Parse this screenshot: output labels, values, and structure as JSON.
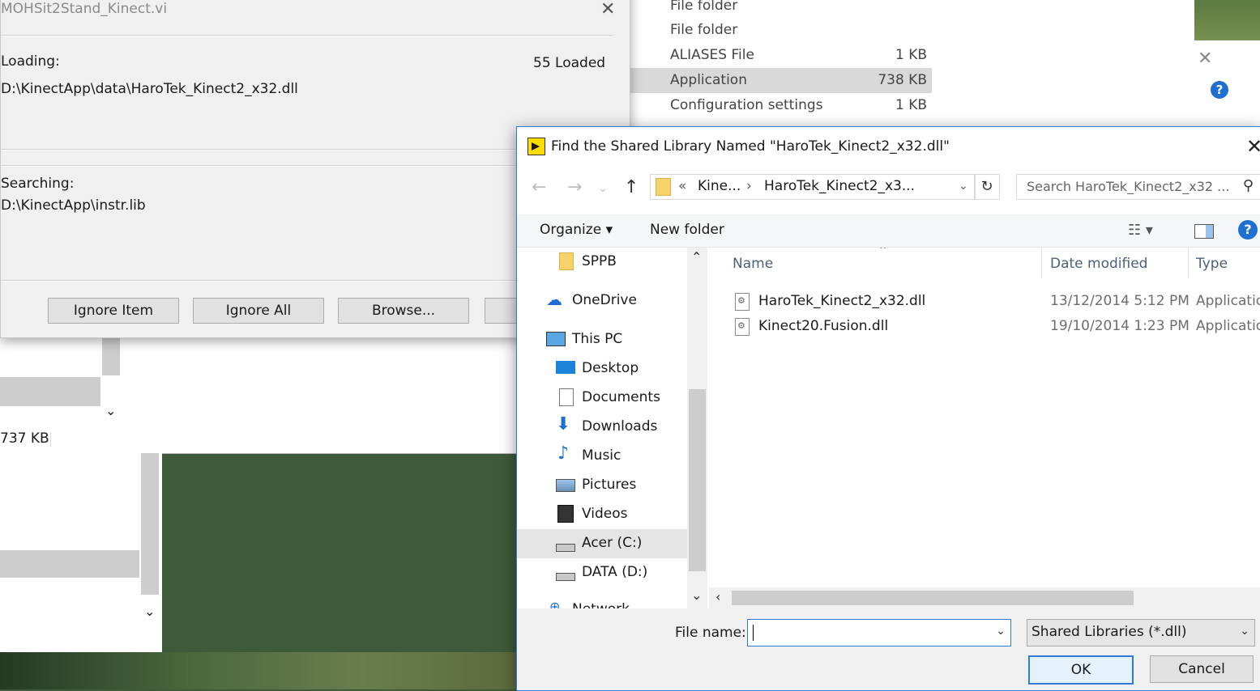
{
  "bg_explorer": {
    "rows": [
      {
        "type": "File folder",
        "size": ""
      },
      {
        "type": "File folder",
        "size": ""
      },
      {
        "type": "ALIASES File",
        "size": "1 KB"
      },
      {
        "type": "Application",
        "size": "738 KB"
      },
      {
        "type": "Configuration settings",
        "size": "1 KB"
      }
    ],
    "partial_size": "737 KB"
  },
  "loading_dialog": {
    "title": "MOHSit2Stand_Kinect.vi",
    "loading_label": "Loading:",
    "loaded_count": "55 Loaded",
    "loading_path": "D:\\KinectApp\\data\\HaroTek_Kinect2_x32.dll",
    "searching_label": "Searching:",
    "searching_path": "D:\\KinectApp\\instr.lib",
    "buttons": {
      "ignore_item": "Ignore Item",
      "ignore_all": "Ignore All",
      "browse": "Browse..."
    }
  },
  "find_dialog": {
    "title": "Find the Shared Library Named \"HaroTek_Kinect2_x32.dll\"",
    "address": {
      "prefix": "«",
      "crumb1": "Kine...",
      "sep": "›",
      "crumb2": "HaroTek_Kinect2_x3..."
    },
    "search_placeholder": "Search HaroTek_Kinect2_x32 ...",
    "toolbar": {
      "organize": "Organize ▾",
      "new_folder": "New folder"
    },
    "nav_items": [
      {
        "label": "SPPB",
        "icon": "folder-icon"
      },
      {
        "label": "OneDrive",
        "icon": "onedrive-icon"
      },
      {
        "label": "This PC",
        "icon": "pc-icon"
      },
      {
        "label": "Desktop",
        "icon": "desktop-icon"
      },
      {
        "label": "Documents",
        "icon": "documents-icon"
      },
      {
        "label": "Downloads",
        "icon": "downloads-icon"
      },
      {
        "label": "Music",
        "icon": "music-icon"
      },
      {
        "label": "Pictures",
        "icon": "pictures-icon"
      },
      {
        "label": "Videos",
        "icon": "videos-icon"
      },
      {
        "label": "Acer (C:)",
        "icon": "drive-icon"
      },
      {
        "label": "DATA (D:)",
        "icon": "drive-icon"
      },
      {
        "label": "Network",
        "icon": "network-icon"
      }
    ],
    "columns": {
      "name": "Name",
      "date": "Date modified",
      "type": "Type"
    },
    "files": [
      {
        "name": "HaroTek_Kinect2_x32.dll",
        "date": "13/12/2014 5:12 PM",
        "type": "Applicatio"
      },
      {
        "name": "Kinect20.Fusion.dll",
        "date": "19/10/2014 1:23 PM",
        "type": "Applicatio"
      }
    ],
    "file_name_label": "File name:",
    "file_name_value": "",
    "file_type": "Shared Libraries (*.dll)",
    "ok": "OK",
    "cancel": "Cancel"
  },
  "colors": {
    "accent": "#2f7cd6",
    "help": "#1e6fd1"
  }
}
